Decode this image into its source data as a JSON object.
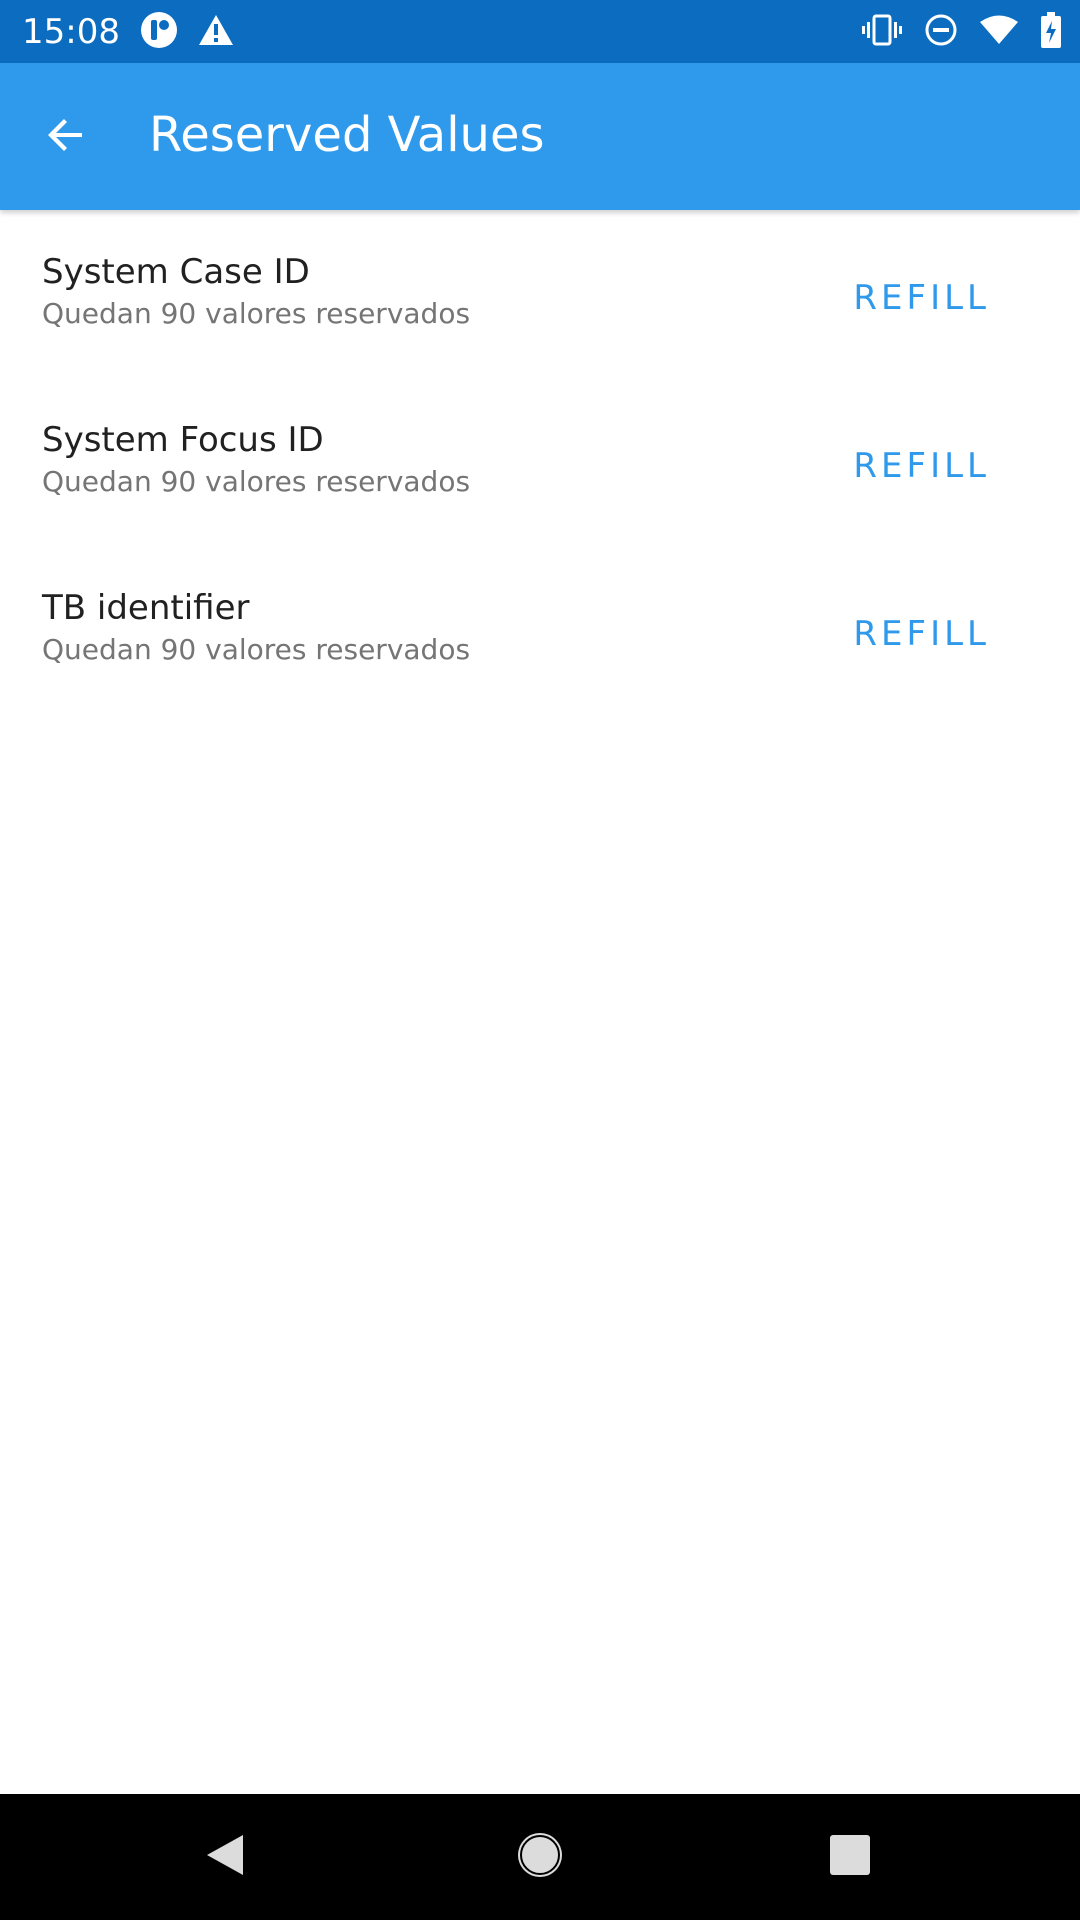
{
  "status_bar": {
    "time": "15:08",
    "left_icons": [
      "notification-app-icon",
      "warning-icon"
    ],
    "right_icons": [
      "vibrate-icon",
      "do-not-disturb-icon",
      "wifi-icon",
      "battery-charging-icon"
    ],
    "background_color": "#0b6cc0"
  },
  "app_bar": {
    "title": "Reserved Values",
    "back_icon": "arrow-back-icon",
    "background_color": "#2f99ec"
  },
  "items": [
    {
      "title": "System Case ID",
      "subtitle": "Quedan 90 valores reservados",
      "action": "REFILL"
    },
    {
      "title": "System Focus ID",
      "subtitle": "Quedan 90 valores reservados",
      "action": "REFILL"
    },
    {
      "title": "TB identifier",
      "subtitle": "Quedan 90 valores reservados",
      "action": "REFILL"
    }
  ],
  "nav_bar": {
    "buttons": [
      "back-triangle-icon",
      "home-circle-icon",
      "recents-square-icon"
    ]
  },
  "colors": {
    "accent": "#2f99ec",
    "title_text": "#212121",
    "subtitle_text": "#757575"
  }
}
